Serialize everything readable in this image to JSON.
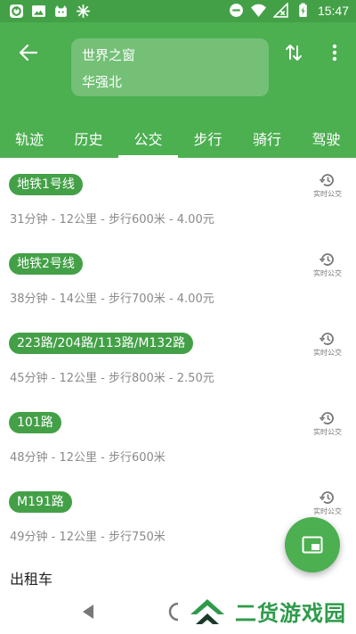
{
  "statusbar": {
    "left_icons": [
      "wechat-icon",
      "image-icon",
      "cat-app-icon",
      "snowflake-icon"
    ],
    "right_icons": [
      "do-not-disturb-icon",
      "wifi-icon",
      "no-signal-icon",
      "battery-charging-icon"
    ],
    "time": "15:47"
  },
  "appbar": {
    "from": "世界之窗",
    "to": "华强北",
    "background": "#4caf50"
  },
  "tabs": [
    {
      "label": "轨迹",
      "active": false
    },
    {
      "label": "历史",
      "active": false
    },
    {
      "label": "公交",
      "active": true
    },
    {
      "label": "步行",
      "active": false
    },
    {
      "label": "骑行",
      "active": false
    },
    {
      "label": "驾驶",
      "active": false
    }
  ],
  "routes": [
    {
      "line": "地铁1号线",
      "detail": "31分钟 - 12公里 - 步行600米 - 4.00元",
      "realtime": "实时公交"
    },
    {
      "line": "地铁2号线",
      "detail": "38分钟 - 14公里 - 步行700米 - 4.00元",
      "realtime": "实时公交"
    },
    {
      "line": "223路/204路/113路/M132路",
      "detail": "45分钟 - 12公里 - 步行800米 - 2.50元",
      "realtime": "实时公交"
    },
    {
      "line": "101路",
      "detail": "48分钟 - 12公里 - 步行600米",
      "realtime": "实时公交"
    },
    {
      "line": "M191路",
      "detail": "49分钟 - 12公里 - 步行750米",
      "realtime": "实时公交"
    }
  ],
  "taxi_label": "出租车",
  "fab_icon": "picture-in-picture-icon",
  "watermark": {
    "text": "二货游戏园"
  },
  "colors": {
    "primary": "#4caf50",
    "badge": "#43a047",
    "statusbar": "#43a047"
  }
}
